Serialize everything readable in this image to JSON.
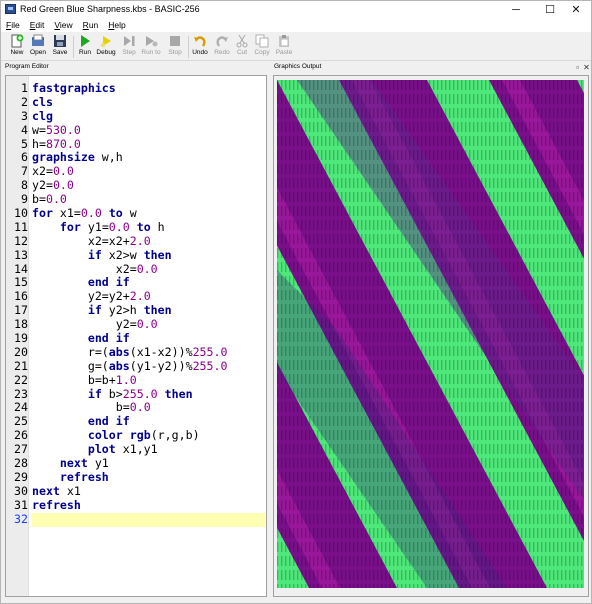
{
  "window": {
    "title": "Red Green Blue Sharpness.kbs - BASIC-256",
    "minimize_glyph": "─",
    "maximize_glyph": "☐",
    "close_glyph": "✕"
  },
  "menu": [
    {
      "u": "F",
      "rest": "ile"
    },
    {
      "u": "E",
      "rest": "dit"
    },
    {
      "u": "V",
      "rest": "iew"
    },
    {
      "u": "R",
      "rest": "un"
    },
    {
      "u": "H",
      "rest": "elp"
    }
  ],
  "toolbar": {
    "new": "New",
    "open": "Open",
    "save": "Save",
    "run": "Run",
    "debug": "Debug",
    "step": "Step",
    "run_to": "Run to",
    "stop": "Stop",
    "undo": "Undo",
    "redo": "Redo",
    "cut": "Cut",
    "copy": "Copy",
    "paste": "Paste"
  },
  "panels": {
    "editor_title": "Program Editor",
    "graphics_title": "Graphics Output",
    "float_glyph": "▫",
    "close_glyph": "✕"
  },
  "editor": {
    "current_line": 32,
    "lines": [
      [
        {
          "t": "fastgraphics",
          "c": "kw"
        }
      ],
      [
        {
          "t": "cls",
          "c": "kw"
        }
      ],
      [
        {
          "t": "clg",
          "c": "kw"
        }
      ],
      [
        {
          "t": "w=",
          "c": ""
        },
        {
          "t": "530.0",
          "c": "num"
        }
      ],
      [
        {
          "t": "h=",
          "c": ""
        },
        {
          "t": "870.0",
          "c": "num"
        }
      ],
      [
        {
          "t": "graphsize",
          "c": "kw"
        },
        {
          "t": " w,h",
          "c": ""
        }
      ],
      [
        {
          "t": "x2=",
          "c": ""
        },
        {
          "t": "0.0",
          "c": "num"
        }
      ],
      [
        {
          "t": "y2=",
          "c": ""
        },
        {
          "t": "0.0",
          "c": "num"
        }
      ],
      [
        {
          "t": "b=",
          "c": ""
        },
        {
          "t": "0.0",
          "c": "num"
        }
      ],
      [
        {
          "t": "for",
          "c": "kw"
        },
        {
          "t": " x1=",
          "c": ""
        },
        {
          "t": "0.0",
          "c": "num"
        },
        {
          "t": " ",
          "c": ""
        },
        {
          "t": "to",
          "c": "kw"
        },
        {
          "t": " w",
          "c": ""
        }
      ],
      [
        {
          "t": "    ",
          "c": ""
        },
        {
          "t": "for",
          "c": "kw"
        },
        {
          "t": " y1=",
          "c": ""
        },
        {
          "t": "0.0",
          "c": "num"
        },
        {
          "t": " ",
          "c": ""
        },
        {
          "t": "to",
          "c": "kw"
        },
        {
          "t": " h",
          "c": ""
        }
      ],
      [
        {
          "t": "        x2=x2+",
          "c": ""
        },
        {
          "t": "2.0",
          "c": "num"
        }
      ],
      [
        {
          "t": "        ",
          "c": ""
        },
        {
          "t": "if",
          "c": "kw"
        },
        {
          "t": " x2>w ",
          "c": ""
        },
        {
          "t": "then",
          "c": "kw"
        }
      ],
      [
        {
          "t": "            x2=",
          "c": ""
        },
        {
          "t": "0.0",
          "c": "num"
        }
      ],
      [
        {
          "t": "        ",
          "c": ""
        },
        {
          "t": "end if",
          "c": "kw"
        }
      ],
      [
        {
          "t": "        y2=y2+",
          "c": ""
        },
        {
          "t": "2.0",
          "c": "num"
        }
      ],
      [
        {
          "t": "        ",
          "c": ""
        },
        {
          "t": "if",
          "c": "kw"
        },
        {
          "t": " y2>h ",
          "c": ""
        },
        {
          "t": "then",
          "c": "kw"
        }
      ],
      [
        {
          "t": "            y2=",
          "c": ""
        },
        {
          "t": "0.0",
          "c": "num"
        }
      ],
      [
        {
          "t": "        ",
          "c": ""
        },
        {
          "t": "end if",
          "c": "kw"
        }
      ],
      [
        {
          "t": "        r=(",
          "c": ""
        },
        {
          "t": "abs",
          "c": "fn"
        },
        {
          "t": "(x1-x2))%",
          "c": ""
        },
        {
          "t": "255.0",
          "c": "num"
        }
      ],
      [
        {
          "t": "        g=(",
          "c": ""
        },
        {
          "t": "abs",
          "c": "fn"
        },
        {
          "t": "(y1-y2))%",
          "c": ""
        },
        {
          "t": "255.0",
          "c": "num"
        }
      ],
      [
        {
          "t": "        b=b+",
          "c": ""
        },
        {
          "t": "1.0",
          "c": "num"
        }
      ],
      [
        {
          "t": "        ",
          "c": ""
        },
        {
          "t": "if",
          "c": "kw"
        },
        {
          "t": " b>",
          "c": ""
        },
        {
          "t": "255.0",
          "c": "num"
        },
        {
          "t": " ",
          "c": ""
        },
        {
          "t": "then",
          "c": "kw"
        }
      ],
      [
        {
          "t": "            b=",
          "c": ""
        },
        {
          "t": "0.0",
          "c": "num"
        }
      ],
      [
        {
          "t": "        ",
          "c": ""
        },
        {
          "t": "end if",
          "c": "kw"
        }
      ],
      [
        {
          "t": "        ",
          "c": ""
        },
        {
          "t": "color",
          "c": "kw"
        },
        {
          "t": " ",
          "c": ""
        },
        {
          "t": "rgb",
          "c": "fn"
        },
        {
          "t": "(r,g,b)",
          "c": ""
        }
      ],
      [
        {
          "t": "        ",
          "c": ""
        },
        {
          "t": "plot",
          "c": "kw"
        },
        {
          "t": " x1,y1",
          "c": ""
        }
      ],
      [
        {
          "t": "    ",
          "c": ""
        },
        {
          "t": "next",
          "c": "kw"
        },
        {
          "t": " y1",
          "c": ""
        }
      ],
      [
        {
          "t": "    ",
          "c": ""
        },
        {
          "t": "refresh",
          "c": "kw"
        }
      ],
      [
        {
          "t": "next",
          "c": "kw"
        },
        {
          "t": " x1",
          "c": ""
        }
      ],
      [
        {
          "t": "refresh",
          "c": "kw"
        }
      ],
      [
        {
          "t": "",
          "c": ""
        }
      ]
    ]
  },
  "colors": {
    "green": "#4ee87a",
    "purple": "#7a0f8a",
    "magenta": "#b01fa8",
    "keyword": "#00008b",
    "number": "#8b008b",
    "current_line_bg": "#ffffb3"
  }
}
